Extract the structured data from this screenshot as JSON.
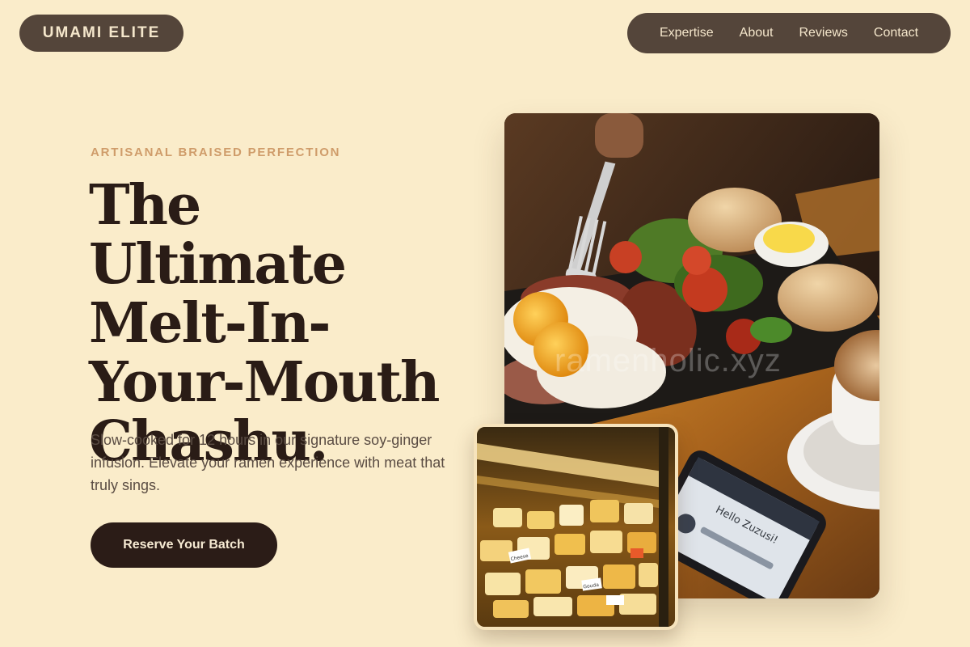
{
  "brand": {
    "name": "UMAMI ELITE"
  },
  "nav": {
    "items": [
      {
        "label": "Expertise"
      },
      {
        "label": "About"
      },
      {
        "label": "Reviews"
      },
      {
        "label": "Contact"
      }
    ]
  },
  "hero": {
    "eyebrow": "ARTISANAL BRAISED PERFECTION",
    "headline_lines": [
      "The Ultimate",
      "Melt-In-",
      "Your-Mouth",
      "Chashu."
    ],
    "description": "Slow-cooked for 12 hours in our signature soy-ginger infusion. Elevate your ramen experience with meat that truly sings.",
    "cta_label": "Reserve Your Batch"
  },
  "media": {
    "main_photo": {
      "watermark": "ramenholic.xyz",
      "phone_text": "Hello Zuzusi!"
    },
    "inset_photo": {
      "labels": [
        "Cheese",
        "Gouda"
      ]
    }
  },
  "colors": {
    "background": "#faecca",
    "pill": "#54453a",
    "eyebrow": "#cf9c6a",
    "headline": "#2a1c16",
    "cta": "#2b1c17"
  }
}
